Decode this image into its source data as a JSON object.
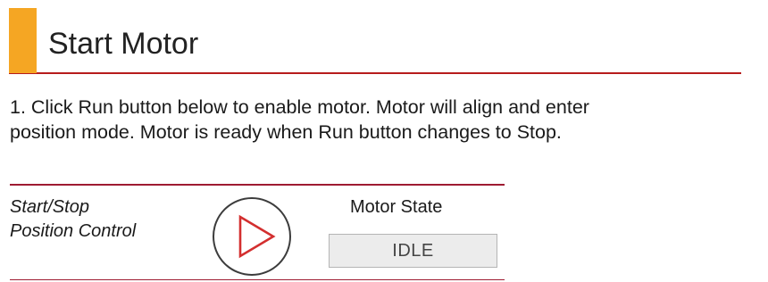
{
  "section": {
    "title": "Start Motor",
    "accent_color": "#f5a623",
    "rule_color": "#b71c1c"
  },
  "instructions": {
    "step1_line1": "1. Click Run button below to enable motor. Motor will align and enter",
    "step1_line2": "position mode. Motor is ready when Run button changes to Stop."
  },
  "control_panel": {
    "label_line1": "Start/Stop",
    "label_line2": "Position Control",
    "run_button_icon": "play-icon",
    "run_icon_color": "#d32f2f",
    "motor_state_label": "Motor State",
    "motor_state_value": "IDLE"
  }
}
